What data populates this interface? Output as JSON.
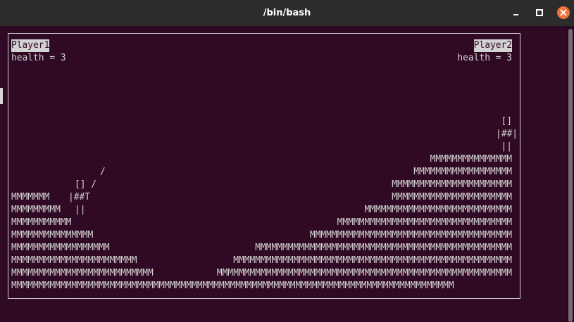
{
  "window": {
    "title": "/bin/bash",
    "minimize_icon": "minimize-icon",
    "maximize_icon": "maximize-icon",
    "close_icon": "close-icon",
    "close_color": "#f0713a"
  },
  "terminal": {
    "background": "#300a24",
    "foreground": "#d3d3d3"
  },
  "game": {
    "player1": {
      "name": "Player1",
      "health_text": "health = 3",
      "health": 3
    },
    "player2": {
      "name": "Player2",
      "health_text": "health = 3",
      "health": 3
    },
    "player2_tank": [
      "[]",
      "|##|",
      "||"
    ],
    "player1_tank": [
      "/",
      "[] /",
      "|##T",
      "||"
    ],
    "terrain_left": [
      "MMMMMMM",
      "MMMMMMMMM",
      "MMMMMMMMMMM",
      "MMMMMMMMMMMMMMM",
      "MMMMMMMMMMMMMMMMMM",
      "MMMMMMMMMMMMMMMMMMMMMMM",
      "MMMMMMMMMMMMMMMMMMMMMMMMMM",
      "MMMMMMMMMMMMMMMMMMMMMMMMMMMMMMMMMMMMMMMMMMMMMMMMMMMMMMMMMMMMMMMMMMMMMMMMMMMMMMMMM"
    ],
    "terrain_right": [
      "MMMMMMMMMMMMMMM",
      "MMMMMMMMMMMMMMMMMM",
      "MMMMMMMMMMMMMMMMMMMMMM",
      "MMMMMMMMMMMMMMMMMMMMMM",
      "MMMMMMMMMMMMMMMMMMMMMMMMMMM",
      "MMMMMMMMMMMMMMMMMMMMMMMMMMMMMMMM",
      "MMMMMMMMMMMMMMMMMMMMMMMMMMMMMMMMMMMMM",
      "MMMMMMMMMMMMMMMMMMMMMMMMMMMMMMMMMMMMMMMMMMMMMMM",
      "MMMMMMMMMMMMMMMMMMMMMMMMMMMMMMMMMMMMMMMMMMMMMMMMMMM",
      "MMMMMMMMMMMMMMMMMMMMMMMMMMMMMMMMMMMMMMMMMMMMMMMMMMMMMM",
      "MMMMMMMMMMMMMMMMMMMMMMMMMMMMMMMMMMMMMMMMMMMMMMMMM"
    ]
  }
}
